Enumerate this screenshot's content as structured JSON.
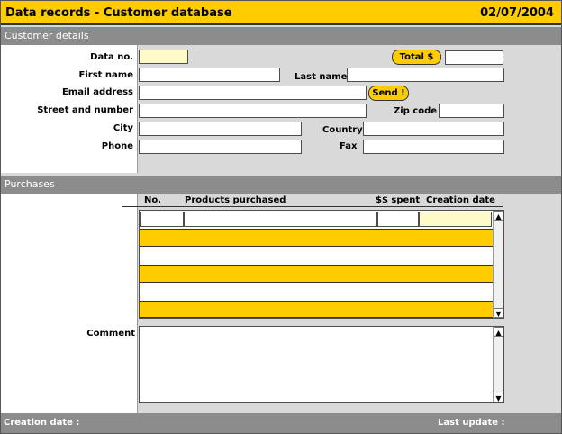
{
  "window": {
    "title": "Data records -  Customer database",
    "date": "02/07/2004"
  },
  "sections": {
    "customer_details": "Customer details",
    "purchases": "Purchases"
  },
  "customer": {
    "data_no_label": "Data no.",
    "data_no_value": "",
    "total_button": "Total $",
    "total_value": "",
    "first_name_label": "First name",
    "first_name_value": "",
    "last_name_label": "Last name",
    "last_name_value": "",
    "email_label": "Email address",
    "email_value": "",
    "send_button": "Send !",
    "street_label": "Street and number",
    "street_value": "",
    "zip_label": "Zip code",
    "zip_value": "",
    "city_label": "City",
    "city_value": "",
    "country_label": "Country",
    "country_value": "",
    "phone_label": "Phone",
    "phone_value": "",
    "fax_label": "Fax",
    "fax_value": ""
  },
  "purchases_table": {
    "columns": [
      "No.",
      "Products purchased",
      "$$ spent",
      "Creation date"
    ],
    "rows": [
      {
        "no": "",
        "product": "",
        "spent": "",
        "date": ""
      }
    ]
  },
  "comment": {
    "label": "Comment",
    "value": ""
  },
  "footer": {
    "creation_label": "Creation date :",
    "update_label": "Last update :"
  },
  "icons": {
    "scroll_up": "▲",
    "scroll_down": "▼"
  },
  "colors": {
    "accent": "#ffcc00",
    "section_bar": "#8c8c8c",
    "field_highlight": "#fffbc8"
  }
}
